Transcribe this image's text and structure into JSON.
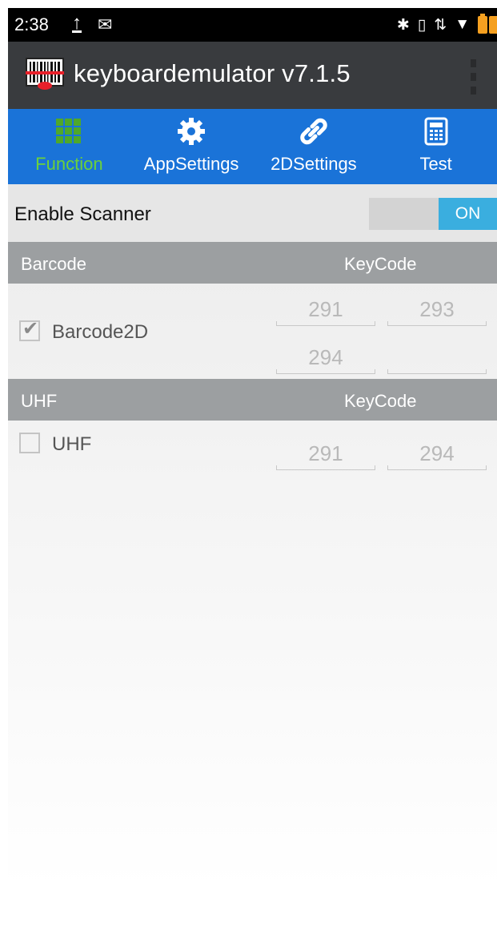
{
  "status_bar": {
    "time": "2:38",
    "icons": [
      "upload-icon",
      "mail-icon",
      "bluetooth-icon",
      "vibrate-icon",
      "data-icon",
      "wifi-icon",
      "battery-icon"
    ]
  },
  "app_bar": {
    "title": "keyboardemulator v7.1.5",
    "logo_icon": "barcode-scanner-icon",
    "menu_icon": "overflow-menu-icon"
  },
  "tabs": [
    {
      "label": "Function",
      "icon": "grid-icon",
      "active": true
    },
    {
      "label": "AppSettings",
      "icon": "gear-icon",
      "active": false
    },
    {
      "label": "2DSettings",
      "icon": "link-icon",
      "active": false
    },
    {
      "label": "Test",
      "icon": "calculator-icon",
      "active": false
    }
  ],
  "enable_scanner": {
    "label": "Enable Scanner",
    "toggle_label": "ON",
    "state": true
  },
  "barcode_section": {
    "header_left": "Barcode",
    "header_right": "KeyCode",
    "rows": [
      {
        "label": "Barcode2D",
        "checked": true,
        "keycodes": [
          "291",
          "293",
          "294",
          ""
        ]
      }
    ]
  },
  "uhf_section": {
    "header_left": "UHF",
    "header_right": "KeyCode",
    "rows": [
      {
        "label": "UHF",
        "checked": false,
        "keycodes": [
          "291",
          "294"
        ]
      }
    ]
  },
  "colors": {
    "action_bar": "#393b3e",
    "tab_bar": "#1a73d8",
    "active_tab": "#6cd13a",
    "toggle_on": "#3aaedf",
    "section_header": "#9c9fa1"
  }
}
